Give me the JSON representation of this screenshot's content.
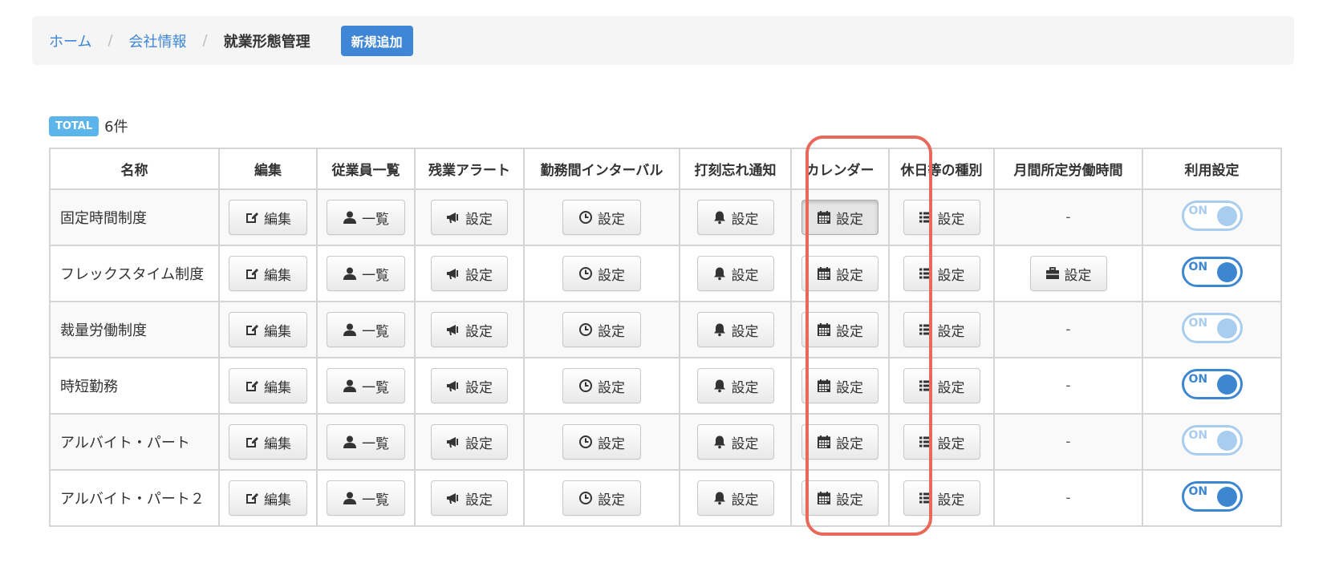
{
  "breadcrumb": {
    "home": "ホーム",
    "company": "会社情報",
    "current": "就業形態管理",
    "separator": "/"
  },
  "new_button": "新規追加",
  "total": {
    "badge": "TOTAL",
    "count": "6件"
  },
  "columns": [
    "名称",
    "編集",
    "従業員一覧",
    "残業アラート",
    "勤務間インターバル",
    "打刻忘れ通知",
    "カレンダー",
    "休日等の種別",
    "月間所定労働時間",
    "利用設定"
  ],
  "button_labels": {
    "edit": "編集",
    "list": "一覧",
    "setting": "設定"
  },
  "dash": "-",
  "toggle_label": "ON",
  "rows": [
    {
      "name": "固定時間制度",
      "monthly_hours": "-",
      "enabled": "ON",
      "enabled_on": false
    },
    {
      "name": "フレックスタイム制度",
      "monthly_hours": "設定",
      "enabled": "ON",
      "enabled_on": true
    },
    {
      "name": "裁量労働制度",
      "monthly_hours": "-",
      "enabled": "ON",
      "enabled_on": false
    },
    {
      "name": "時短勤務",
      "monthly_hours": "-",
      "enabled": "ON",
      "enabled_on": true
    },
    {
      "name": "アルバイト・パート",
      "monthly_hours": "-",
      "enabled": "ON",
      "enabled_on": false
    },
    {
      "name": "アルバイト・パート２",
      "monthly_hours": "-",
      "enabled": "ON",
      "enabled_on": true
    }
  ],
  "highlighted_column": "カレンダー",
  "colors": {
    "accent": "#3f86d6",
    "highlight": "#e8695a",
    "badge": "#5bb4ea"
  }
}
